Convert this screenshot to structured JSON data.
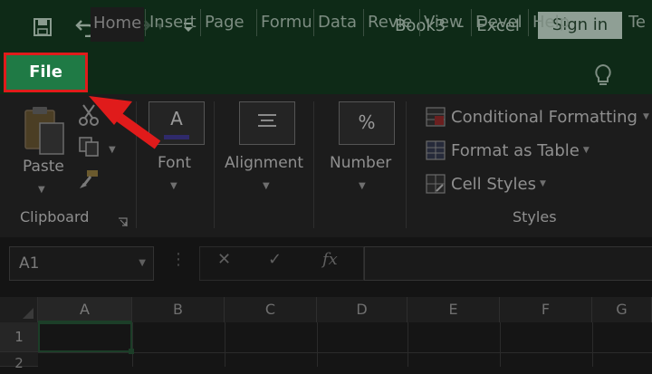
{
  "window": {
    "doc_name": "Book3",
    "separator": "-",
    "app_name": "Excel",
    "sign_in_label": "Sign in"
  },
  "tabs": {
    "file": "File",
    "home": "Home",
    "insert": "Insert",
    "page": "Page",
    "formulas": "Formu",
    "data": "Data",
    "review": "Revie",
    "view": "View",
    "developer": "Devel",
    "help": "Help",
    "tell": "Te"
  },
  "ribbon": {
    "clipboard": {
      "paste_label": "Paste",
      "group_label": "Clipboard"
    },
    "font": {
      "label": "Font",
      "icon_letter": "A"
    },
    "alignment": {
      "label": "Alignment"
    },
    "number": {
      "label": "Number",
      "icon_symbol": "%"
    },
    "styles": {
      "conditional_formatting": "Conditional Formatting",
      "format_as_table": "Format as Table",
      "cell_styles": "Cell Styles",
      "group_label": "Styles"
    }
  },
  "formula_bar": {
    "name_box_value": "A1",
    "fx_label": "fx"
  },
  "grid": {
    "columns": [
      "A",
      "B",
      "C",
      "D",
      "E",
      "F",
      "G"
    ],
    "rows": [
      "1",
      "2"
    ]
  },
  "annotation": {
    "arrow_color": "#e01b1b",
    "highlight_color": "#e01b1b"
  },
  "colors": {
    "excel_green": "#1f7a45",
    "titlebar": "#0e2a17"
  }
}
